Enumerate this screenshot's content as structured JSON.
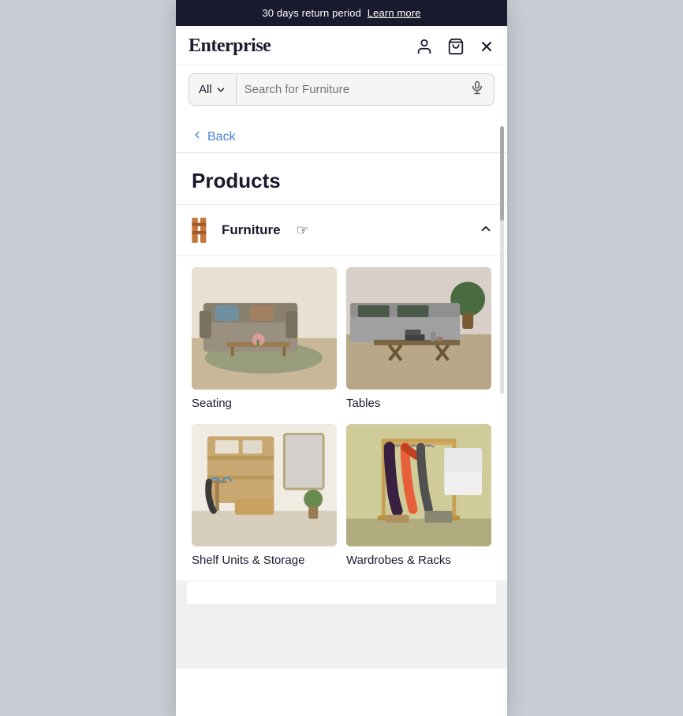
{
  "banner": {
    "text": "30 days return period",
    "link_text": "Learn more"
  },
  "header": {
    "logo": "Enterprise",
    "icons": {
      "user": "👤",
      "cart": "🛒",
      "close": "✕"
    }
  },
  "search": {
    "category": "All",
    "placeholder": "Search for Furniture",
    "mic_icon": "🎙"
  },
  "nav": {
    "back_label": "Back",
    "products_heading": "Products",
    "furniture_category": "Furniture",
    "subcategories": [
      {
        "name": "Seating"
      },
      {
        "name": "Tables"
      },
      {
        "name": "Shelf Units & Storage"
      },
      {
        "name": "Wardrobes & Racks"
      }
    ]
  }
}
